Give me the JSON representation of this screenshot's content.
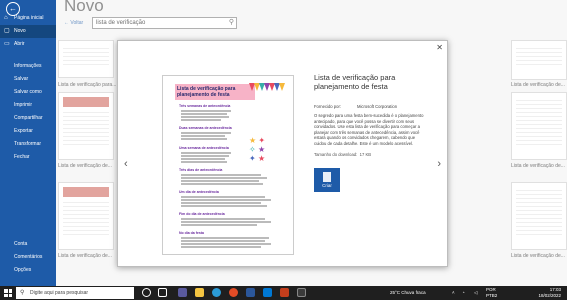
{
  "nav": {
    "items": [
      {
        "label": "Página inicial",
        "icon": "home-icon"
      },
      {
        "label": "Novo",
        "icon": "new-doc-icon"
      },
      {
        "label": "Abrir",
        "icon": "folder-icon"
      },
      {
        "label": "Informações"
      },
      {
        "label": "Salvar"
      },
      {
        "label": "Salvar como"
      },
      {
        "label": "Imprimir"
      },
      {
        "label": "Compartilhar"
      },
      {
        "label": "Exportar"
      },
      {
        "label": "Transformar"
      },
      {
        "label": "Fechar"
      },
      {
        "label": "Conta"
      },
      {
        "label": "Comentários"
      },
      {
        "label": "Opções"
      }
    ]
  },
  "header": {
    "title": "Novo",
    "back_label": "Voltar"
  },
  "search": {
    "value": "lista de verificação"
  },
  "tiles": {
    "captions": [
      "Lista de verificação para...",
      "Lista de verificação de...",
      "Lista de verificação de...",
      "Lista de verificação de...",
      "Lista de verificação de...",
      "Lista de verificação de..."
    ]
  },
  "modal": {
    "title": "Lista de verificação para planejamento de festa",
    "provider_label": "Fornecido por:",
    "provider": "Microsoft Corporation",
    "description": "O segredo para uma festa bem-sucedida é o planejamento antecipado, para que você possa se divertir com seus convidados. Use esta lista de verificação para começar a planejar com três semanas de antecedência, assim você estará quando os convidados chegarem, cabendo que cuidou de cada detalhe. Este é um modelo acessível.",
    "size_label": "Tamanho do download:",
    "size": "17 KB",
    "create_label": "Criar",
    "preview": {
      "title": "Lista de verificação para planejamento de festa",
      "sections": [
        "Três semanas de antecedência",
        "Duas semanas de antecedência",
        "Uma semana de antecedência",
        "Três dias de antecedência",
        "Um dia de antecedência",
        "Fim do dia de antecedência",
        "No dia da festa"
      ]
    }
  },
  "taskbar": {
    "search_placeholder": "Digite aqui para pesquisar",
    "weather": "25°C  Chuva fraca",
    "lang": "POR PTB2",
    "time": "17:03",
    "date": "18/02/2022"
  },
  "colors": {
    "accent": "#1e5ba8",
    "nav_active": "#14477f",
    "taskbar": "#1f1f1f"
  }
}
